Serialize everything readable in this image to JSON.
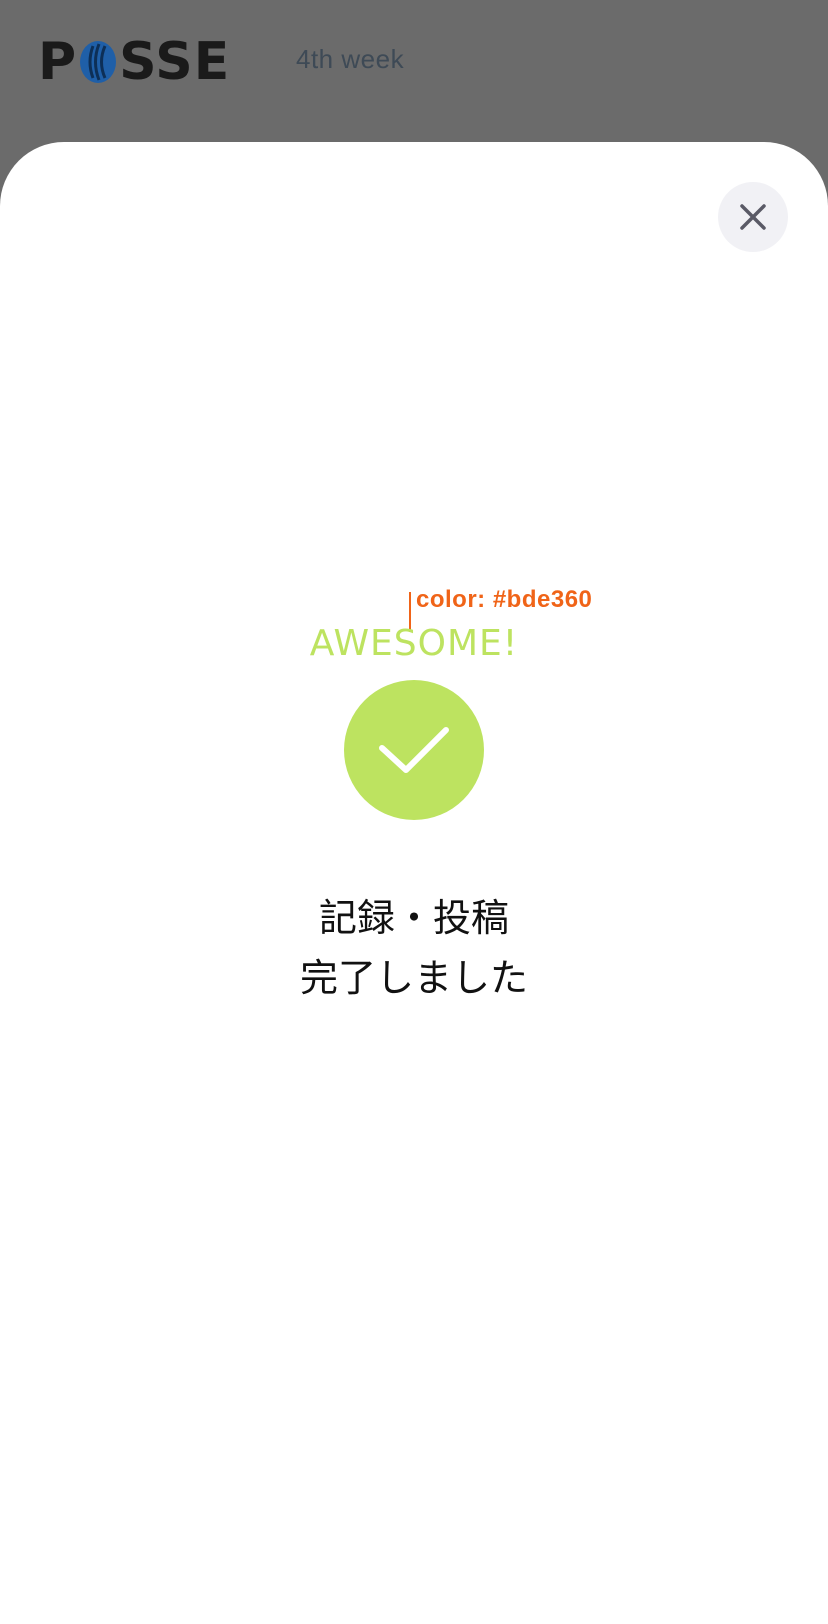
{
  "header": {
    "logo_text_left": "P",
    "logo_text_right": "SSE",
    "week_label": "4th week"
  },
  "modal": {
    "close_icon": "close-icon",
    "annotation": "color: #bde360",
    "heading": "AWESOME!",
    "check_icon": "checkmark-icon",
    "message_line1": "記録・投稿",
    "message_line2": "完了しました"
  },
  "colors": {
    "accent": "#bde360",
    "annotation": "#f06418",
    "logo_blue": "#1f5fa8",
    "overlay": "#6b6b6b"
  }
}
